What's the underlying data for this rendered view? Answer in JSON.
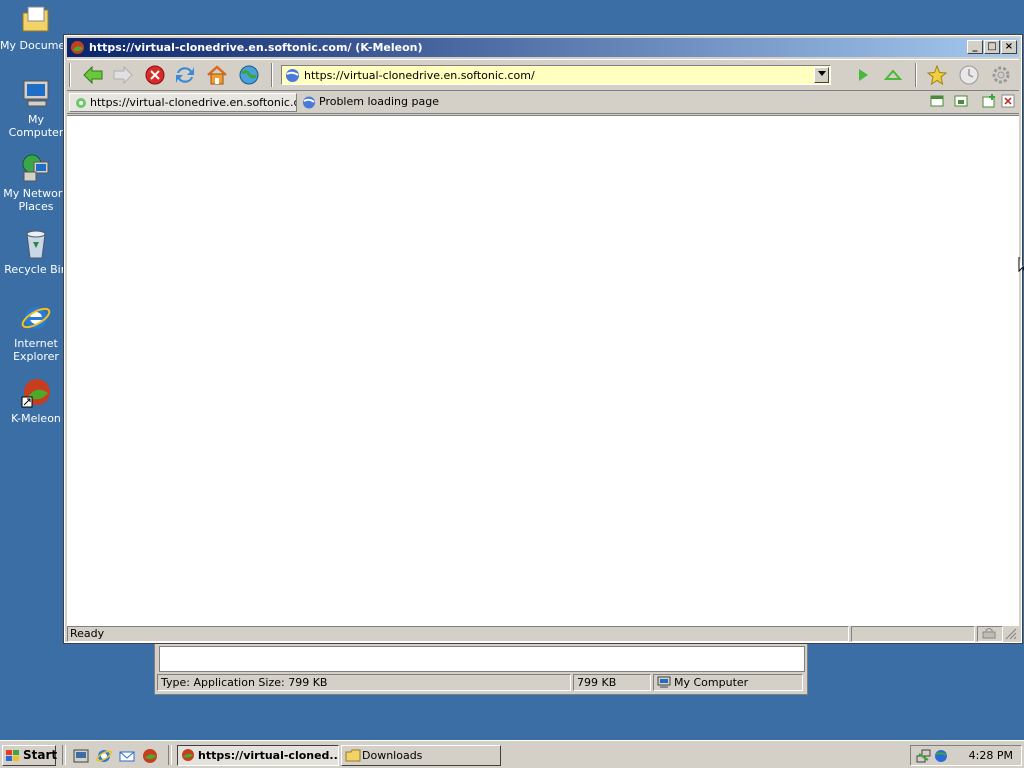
{
  "desktop": {
    "icons": [
      {
        "label": "My Documents"
      },
      {
        "label": "My Computer"
      },
      {
        "label": "My Network Places"
      },
      {
        "label": "Recycle Bin"
      },
      {
        "label": "Internet Explorer"
      },
      {
        "label": "K-Meleon"
      }
    ]
  },
  "browser": {
    "title": "https://virtual-clonedrive.en.softonic.com/ (K-Meleon)",
    "url": "https://virtual-clonedrive.en.softonic.com/",
    "tabs": [
      {
        "label": "https://virtual-clonedrive.en.softonic.c..."
      },
      {
        "label": "Problem loading page"
      }
    ],
    "status": "Ready"
  },
  "downloads_window": {
    "status_type": "Type: Application Size: 799 KB",
    "status_size": "799 KB",
    "status_zone": "My Computer"
  },
  "taskbar": {
    "start_label": "Start",
    "tasks": [
      {
        "label": "https://virtual-cloned..."
      },
      {
        "label": "Downloads"
      }
    ],
    "clock": "4:28 PM"
  },
  "colors": {
    "desktop": "#3a6ea5",
    "titlebar_start": "#0a246a",
    "titlebar_end": "#a6caf0",
    "url_bg": "#ffffc0"
  }
}
